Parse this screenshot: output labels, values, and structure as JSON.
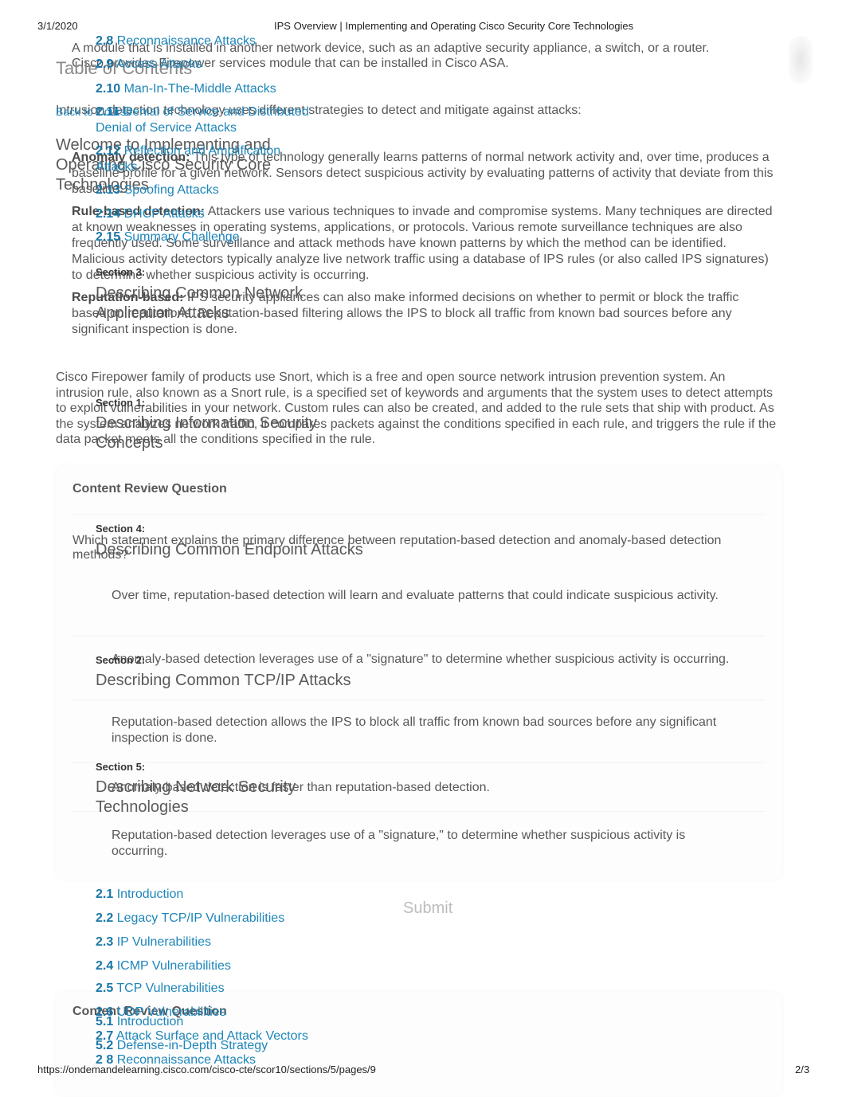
{
  "print_header": {
    "date": "3/1/2020",
    "title": "IPS Overview | Implementing and Operating Cisco Security Core Technologies"
  },
  "print_footer": {
    "url": "https://ondemandelearning.cisco.com/cisco-cte/scor10/sections/5/pages/9",
    "page": "2/3"
  },
  "main": {
    "intro_lines": [
      "A module that is installed in another network device, such as an adaptive security appliance, a switch, or a router.",
      "Cisco provides Firepower services module that can be installed in Cisco ASA."
    ],
    "strategies_intro": "Intrusion detection technology uses different strategies to detect and mitigate against attacks:",
    "strategies": [
      {
        "term": "Anomaly detection:",
        "text": "This type of technology generally learns patterns of normal network activity and, over time, produces a baseline profile for a given network. Sensors detect suspicious activity by evaluating patterns of activity that deviate from this baseline."
      },
      {
        "term": "Rule-based detection:",
        "text": "Attackers use various techniques to invade and compromise systems. Many techniques are directed at known weaknesses in operating systems, applications, or protocols. Various remote surveillance techniques are also frequently used. Some surveillance and attack methods have known patterns by which the method can be identified. Malicious activity detectors typically analyze live network traffic using a database of IPS rules (or also called IPS signatures) to determine whether suspicious activity is occurring."
      },
      {
        "term": "Reputation-based:",
        "text": "IPS security appliances can also make informed decisions on whether to permit or block the traffic based on reputations. Reputation-based filtering allows the IPS to block all traffic from known bad sources before any significant inspection is done."
      }
    ],
    "snort_paragraph": "Cisco Firepower family of products use Snort, which is a free and open source network intrusion prevention system. An intrusion rule, also known as a Snort rule, is a specified set of keywords and arguments that the system uses to detect attempts to exploit vulnerabilities in your network. Custom rules can also be created, and added to the rule sets that ship with product. As the system analyzes network traffic, it compares packets against the conditions specified in each rule, and triggers the rule if the data packet meets all the conditions specified in the rule.",
    "review": {
      "title": "Content Review Question",
      "question": "Which statement explains the primary difference between reputation-based detection and anomaly-based detection methods?",
      "options": [
        "Over time, reputation-based detection will learn and evaluate patterns that could indicate suspicious activity.",
        "Anomaly-based detection leverages use of a \"signature\" to determine whether suspicious activity is occurring.",
        "Reputation-based detection allows the IPS to block all traffic from known bad sources before any significant inspection is done.",
        "Anomaly-based detection is faster than reputation-based detection.",
        "Reputation-based detection leverages use of a \"signature,\" to determine whether suspicious activity is occurring."
      ],
      "submit_label": "Submit"
    },
    "review2_title": "Content Review Question"
  },
  "toc": {
    "title": "Table of Contents",
    "back_label": "Back to Course",
    "welcome": [
      "Welcome to Implementing and",
      "Operating Cisco Security Core",
      "Technologies"
    ],
    "top_links": [
      {
        "num": "2.8",
        "label": "Reconnaissance Attacks"
      },
      {
        "num": "2.9",
        "label": "Access Attacks"
      },
      {
        "num": "2.10",
        "label": "Man-In-The-Middle Attacks"
      },
      {
        "num": "2.11",
        "label": "Denial of Service and Distributed",
        "label2": "Denial of Service Attacks"
      },
      {
        "num": "2.12",
        "label": "Reflection and Amplification",
        "label2": "Attacks"
      },
      {
        "num": "2.13",
        "label": "Spoofing Attacks"
      },
      {
        "num": "2.14",
        "label": "DHCP Attacks"
      },
      {
        "num": "2.15",
        "label": "Summary Challenge"
      }
    ],
    "sections": [
      {
        "label": "Section 3:",
        "title": [
          "Describing Common Network",
          "Application Attacks"
        ]
      },
      {
        "label": "Section 1:",
        "title": [
          "Describing Information Security",
          "Concepts"
        ]
      },
      {
        "label": "Section 4:",
        "title": [
          "Describing Common Endpoint Attacks"
        ]
      },
      {
        "label": "Section 2:",
        "title": [
          "Describing Common TCP/IP Attacks"
        ]
      },
      {
        "label": "Section 5:",
        "title": [
          "Describing Network Security",
          "Technologies"
        ]
      }
    ],
    "section2_links": [
      {
        "num": "2.1",
        "label": "Introduction"
      },
      {
        "num": "2.2",
        "label": "Legacy TCP/IP Vulnerabilities"
      },
      {
        "num": "2.3",
        "label": "IP Vulnerabilities"
      },
      {
        "num": "2.4",
        "label": "ICMP Vulnerabilities"
      },
      {
        "num": "2.5",
        "label": "TCP Vulnerabilities"
      },
      {
        "num": "2.6",
        "label": "UDP Vulnerabilities"
      },
      {
        "num": "2.7",
        "label": "Attack Surface and Attack Vectors"
      },
      {
        "num": "2 8",
        "label": "Reconnaissance Attacks"
      }
    ],
    "section5_links": [
      {
        "num": "5.1",
        "label": "Introduction"
      },
      {
        "num": "5.2",
        "label": "Defense-in-Depth Strategy"
      }
    ]
  }
}
